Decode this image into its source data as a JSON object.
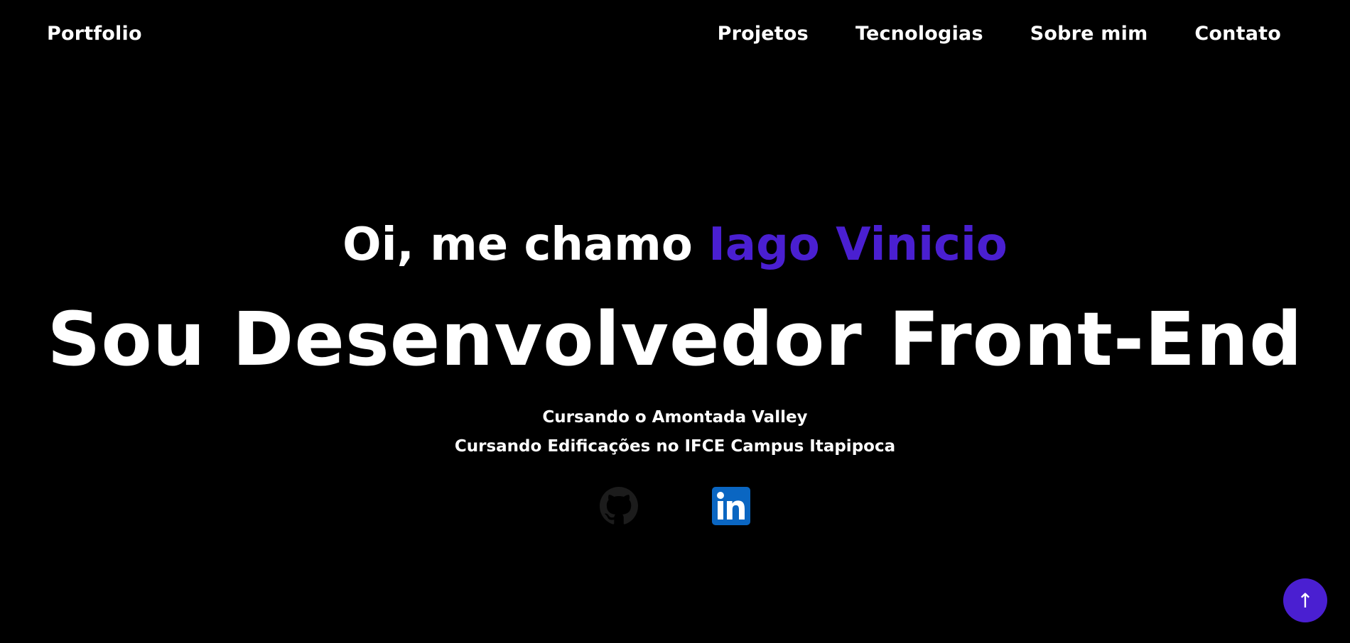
{
  "header": {
    "logo": "Portfolio",
    "nav": [
      {
        "label": "Projetos"
      },
      {
        "label": "Tecnologias"
      },
      {
        "label": "Sobre mim"
      },
      {
        "label": "Contato"
      }
    ]
  },
  "hero": {
    "greeting_prefix": "Oi, me chamo ",
    "name": "Iago Vinicio",
    "headline": "Sou Desenvolvedor Front-End",
    "lines": [
      "Cursando o Amontada Valley",
      "Cursando Edificações no IFCE Campus Itapipoca"
    ]
  },
  "socials": [
    {
      "icon": "github-icon"
    },
    {
      "icon": "linkedin-icon"
    }
  ],
  "back_to_top": {
    "glyph": "↑"
  },
  "colors": {
    "background": "#000000",
    "text": "#ffffff",
    "accent": "#4a1fd1",
    "linkedin": "#0a66c2",
    "github": "#1c1c1c"
  }
}
